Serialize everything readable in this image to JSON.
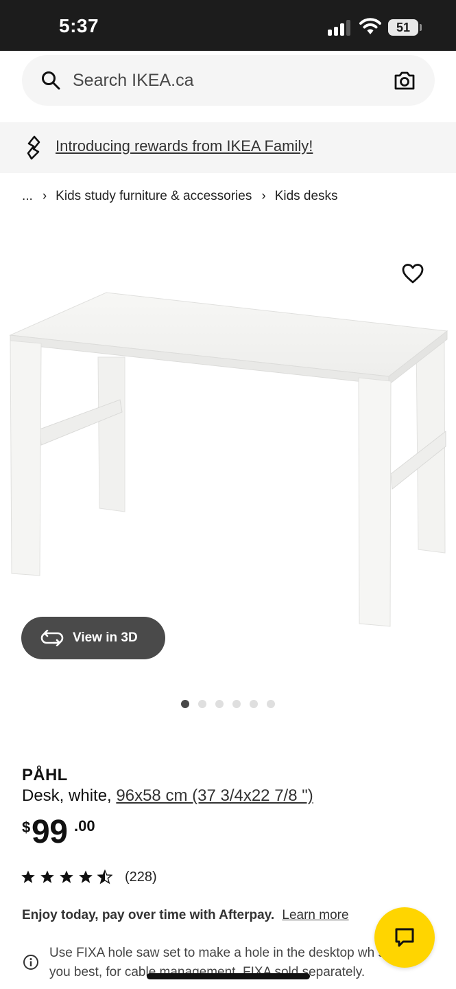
{
  "status_bar": {
    "time": "5:37",
    "battery_level": "51",
    "icons": [
      "signal-icon",
      "wifi-icon",
      "battery-icon"
    ]
  },
  "search": {
    "placeholder": "Search IKEA.ca",
    "icon": "search-icon",
    "camera_icon": "camera-icon"
  },
  "promo": {
    "text": "Introducing rewards from IKEA Family!",
    "icon": "ikea-family-icon"
  },
  "breadcrumb": {
    "ellipsis": "...",
    "items": [
      "Kids study furniture & accessories",
      "Kids desks"
    ],
    "separator": "›"
  },
  "gallery": {
    "view_3d_label": "View in 3D",
    "slide_count": 6,
    "active_slide": 1,
    "favorite_icon": "heart-icon"
  },
  "product": {
    "name": "PÅHL",
    "description": "Desk, white,",
    "size": "96x58 cm (37 3/4x22 7/8 \")",
    "price": {
      "currency": "$",
      "integer": "99",
      "decimal": ".00"
    },
    "rating": {
      "stars": 4.5,
      "max": 5,
      "count": "(228)"
    }
  },
  "afterpay": {
    "text": "Enjoy today, pay over time with Afterpay.",
    "link": "Learn more"
  },
  "notice": {
    "icon": "info-icon",
    "text": "Use FIXA hole saw set to make a hole in the desktop wh suits you best, for cable management. FIXA sold separately."
  },
  "chat": {
    "icon": "chat-icon"
  },
  "colors": {
    "chat_button": "#ffd500",
    "status_bar": "#1c1c1c",
    "view_3d_button": "#4a4a4a"
  }
}
